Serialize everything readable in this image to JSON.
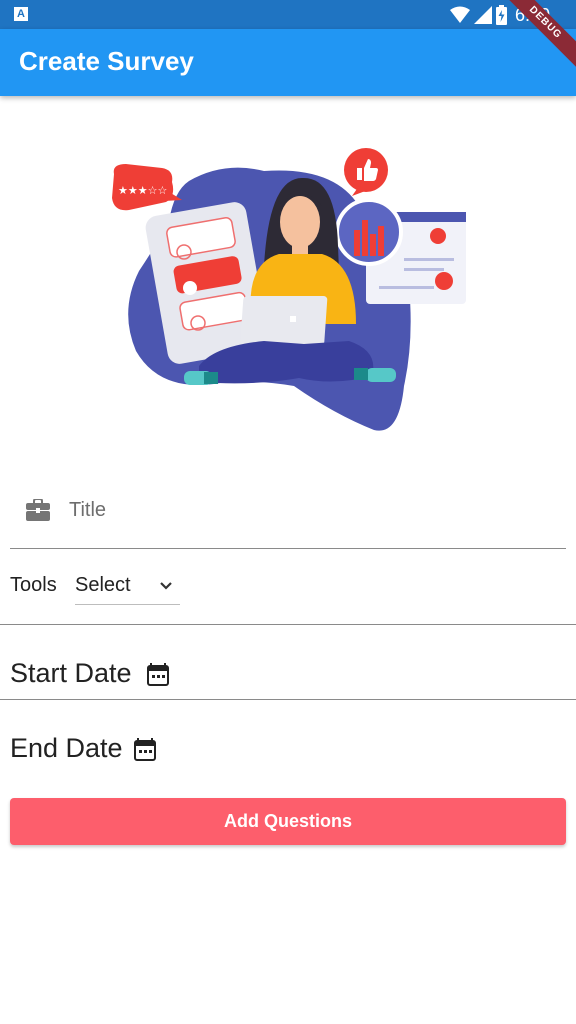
{
  "status_bar": {
    "notification_badge": "A",
    "time": "6:00",
    "icons": [
      "wifi-icon",
      "cellular-signal-icon",
      "battery-charging-icon"
    ]
  },
  "debug_banner": "DEBUG",
  "app_bar": {
    "title": "Create Survey",
    "color": "#2196f3"
  },
  "illustration": {
    "rating_stars": "★★★☆☆"
  },
  "form": {
    "title_placeholder": "Title",
    "tools_label": "Tools",
    "tools_selected": "Select",
    "start_date_label": "Start Date",
    "end_date_label": "End Date",
    "add_button_label": "Add Questions",
    "button_color": "#fd5e6c"
  }
}
